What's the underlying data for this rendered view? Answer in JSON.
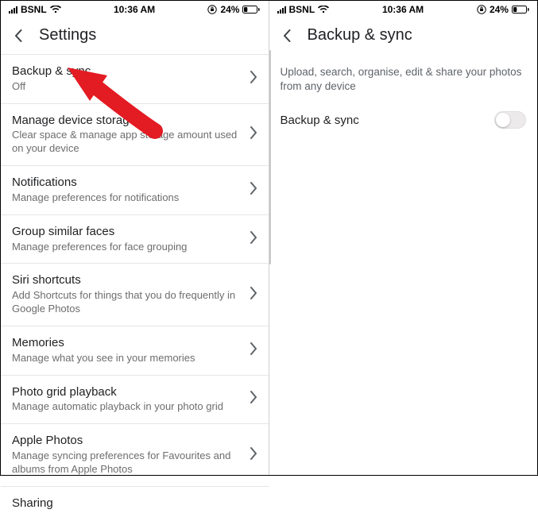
{
  "status": {
    "carrier": "BSNL",
    "time": "10:36 AM",
    "battery_text": "24%"
  },
  "left": {
    "title": "Settings",
    "items": [
      {
        "title": "Backup & sync",
        "sub": "Off"
      },
      {
        "title": "Manage device storage",
        "sub": "Clear space & manage app storage amount used on your device"
      },
      {
        "title": "Notifications",
        "sub": "Manage preferences for notifications"
      },
      {
        "title": "Group similar faces",
        "sub": "Manage preferences for face grouping"
      },
      {
        "title": "Siri shortcuts",
        "sub": "Add Shortcuts for things that you do frequently in Google Photos"
      },
      {
        "title": "Memories",
        "sub": "Manage what you see in your memories"
      },
      {
        "title": "Photo grid playback",
        "sub": "Manage automatic playback in your photo grid"
      },
      {
        "title": "Apple Photos",
        "sub": "Manage syncing preferences for Favourites and albums from Apple Photos"
      }
    ],
    "footer_item": "Sharing"
  },
  "right": {
    "title": "Backup & sync",
    "subhead": "Upload, search, organise, edit & share your photos from any device",
    "toggle_label": "Backup & sync"
  }
}
